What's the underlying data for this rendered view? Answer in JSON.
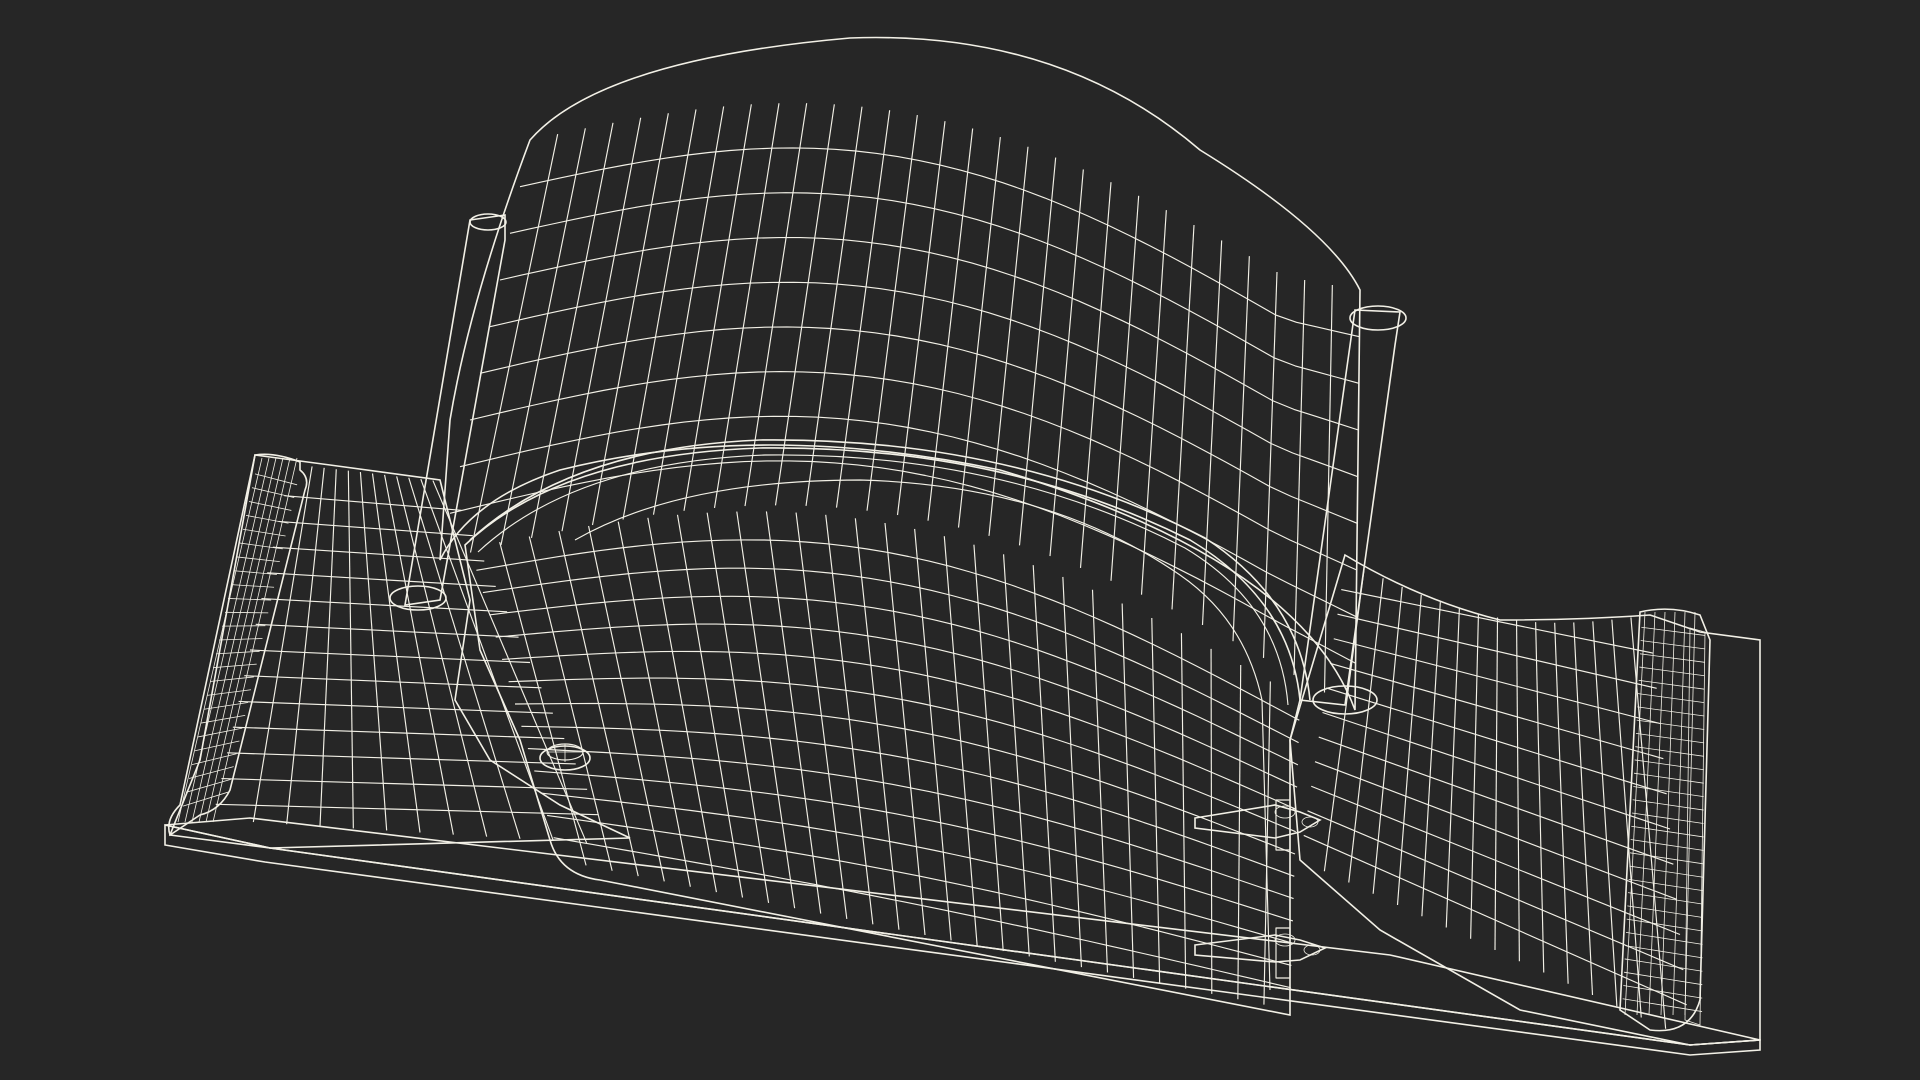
{
  "scene": {
    "subject": "wireframe-mantel-clock-case",
    "colors": {
      "background": "#262626",
      "surface": "#7e7f72",
      "surface_shade": "#6f7065",
      "surface_light": "#8a8b7e",
      "wire": "#f2f0e6"
    }
  }
}
